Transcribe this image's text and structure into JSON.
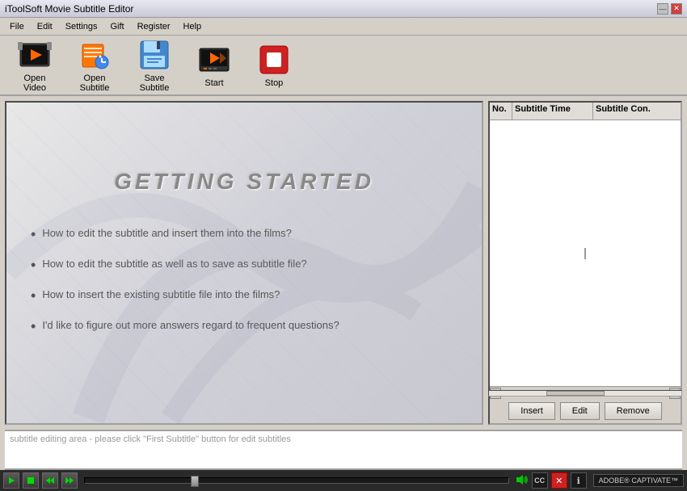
{
  "window": {
    "title": "iToolSoft Movie Subtitle Editor",
    "title_divider": "|"
  },
  "title_buttons": {
    "minimize": "—",
    "close": "✕"
  },
  "menu": {
    "items": [
      "File",
      "Edit",
      "Settings",
      "Gift",
      "Register",
      "Help"
    ]
  },
  "toolbar": {
    "buttons": [
      {
        "id": "open-video",
        "label": "Open Video"
      },
      {
        "id": "open-subtitle",
        "label": "Open Subtitle"
      },
      {
        "id": "save-subtitle",
        "label": "Save Subtitle"
      },
      {
        "id": "start",
        "label": "Start"
      },
      {
        "id": "stop",
        "label": "Stop"
      }
    ]
  },
  "preview": {
    "title": "GETTING   STARTED",
    "bullets": [
      "How to edit the subtitle and insert them into the films?",
      "How to edit the subtitle as well as to save as subtitle file?",
      "How to insert the existing subtitle file into the films?",
      "I'd like to figure out more answers regard to frequent questions?"
    ]
  },
  "subtitle_table": {
    "columns": [
      "No.",
      "Subtitle Time",
      "Subtitle Con."
    ],
    "rows": []
  },
  "subtitle_buttons": {
    "insert": "Insert",
    "edit": "Edit",
    "remove": "Remove"
  },
  "edit_area": {
    "placeholder": "subtitle editing area - please click \"First Subtitle\" button for edit subtitles"
  },
  "playback": {
    "adobe_label": "ADOBE® CAPTIVATE™"
  }
}
